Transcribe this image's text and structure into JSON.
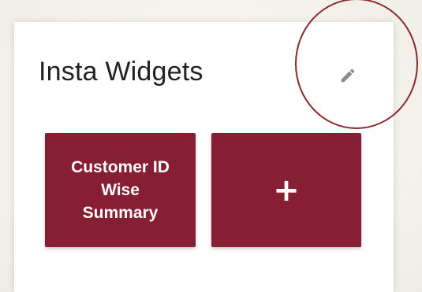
{
  "widget_panel": {
    "title": "Insta Widgets",
    "edit_icon": "pencil-icon",
    "tiles": [
      {
        "label": "Customer ID Wise Summary"
      },
      {
        "label": "+",
        "icon": "plus-icon"
      }
    ]
  },
  "colors": {
    "tile_background": "#861f33",
    "tile_text": "#ffffff",
    "highlight_ring": "#8b2a2e",
    "edit_icon": "#8a8a8a"
  }
}
